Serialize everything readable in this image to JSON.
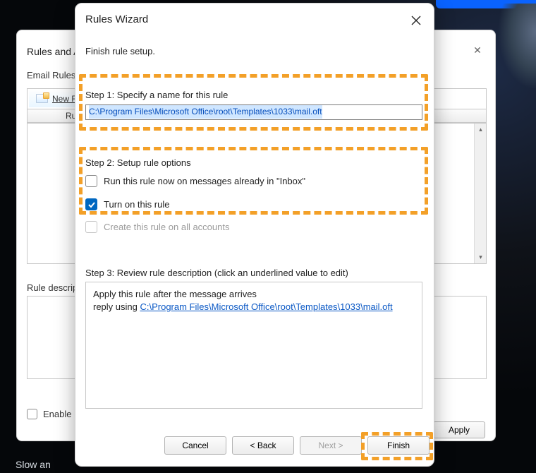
{
  "background": {
    "bottom_text_fragment": "Slow an"
  },
  "rules_window": {
    "title": "Rules and Alerts",
    "tab_email_rules": "Email Rules",
    "btn_new_rule": "New Rule...",
    "list_col_rule": "Rule (applied in the order shown)",
    "desc_label": "Rule description (click an underlined value to edit):",
    "enable_all_label": "Enable rules on all messages downloaded from RSS Feeds",
    "apply_label": "Apply"
  },
  "wizard": {
    "title": "Rules Wizard",
    "subtitle": "Finish rule setup.",
    "step1_label": "Step 1: Specify a name for this rule",
    "rule_name_value": "C:\\Program Files\\Microsoft Office\\root\\Templates\\1033\\mail.oft",
    "step2_label": "Step 2: Setup rule options",
    "opt_run_now": "Run this rule now on messages already in \"Inbox\"",
    "opt_turn_on": "Turn on this rule",
    "opt_all_accounts": "Create this rule on all accounts",
    "step3_label": "Step 3: Review rule description (click an underlined value to edit)",
    "desc_line1": "Apply this rule after the message arrives",
    "desc_line2_prefix": "reply using ",
    "desc_line2_link": "C:\\Program Files\\Microsoft Office\\root\\Templates\\1033\\mail.oft",
    "btn_cancel": "Cancel",
    "btn_back": "< Back",
    "btn_next": "Next >",
    "btn_finish": "Finish"
  }
}
